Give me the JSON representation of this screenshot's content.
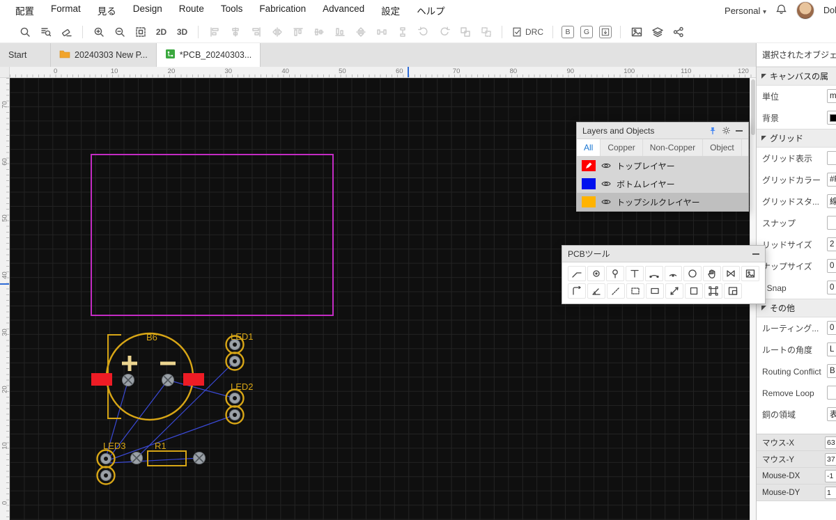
{
  "menu_bar": {
    "items": [
      "配置",
      "Format",
      "見る",
      "Design",
      "Route",
      "Tools",
      "Fabrication",
      "Advanced",
      "設定",
      "ヘルプ"
    ],
    "account_label": "Personal",
    "user_name": "Dol"
  },
  "toolbar": {
    "view_2d": "2D",
    "view_3d": "3D",
    "drc_label": "DRC",
    "bom_label": "B",
    "gerber_label": "G",
    "icons": [
      "search-icon",
      "net-search-icon",
      "eraser-icon",
      "zoom-in-icon",
      "zoom-out-icon",
      "zoom-fit-icon",
      "align-left-icon",
      "align-center-horizontal-icon",
      "align-right-icon",
      "flip-horizontal-icon",
      "align-top-icon",
      "align-middle-icon",
      "align-bottom-icon",
      "flip-vertical-icon",
      "distribute-horizontal-icon",
      "distribute-vertical-icon",
      "rotate-ccw-icon",
      "rotate-cw-icon",
      "group-icon",
      "ungroup-icon",
      "drc-icon",
      "export-board-icon",
      "image-export-icon",
      "layer-stack-icon",
      "share-icon"
    ]
  },
  "tabs": {
    "start": "Start",
    "project": "20240303 New P...",
    "pcb": "*PCB_20240303..."
  },
  "rulers": {
    "horizontal": [
      "0",
      "10",
      "20",
      "30",
      "40",
      "50",
      "60",
      "70",
      "80",
      "90",
      "100",
      "110",
      "120"
    ],
    "vertical": [
      "70",
      "60",
      "50",
      "40",
      "30",
      "20",
      "10",
      "0"
    ]
  },
  "canvas": {
    "colors": {
      "background": "#0f0f0f",
      "grid": "#232323",
      "board_outline": "#c32bc3",
      "silkscreen": "#d8a616",
      "top_layer_pad": "#ee1c25",
      "through_hole_pad": "#9ba1a7",
      "ratsnest": "#3a49d6"
    },
    "components": {
      "battery": "B6",
      "led1": "LED1",
      "led2": "LED2",
      "led3": "LED3",
      "resistor": "R1"
    }
  },
  "layers_panel": {
    "title": "Layers and Objects",
    "tabs": [
      "All",
      "Copper",
      "Non-Copper",
      "Object"
    ],
    "layers": [
      {
        "name": "トップレイヤー",
        "color": "#ff0000"
      },
      {
        "name": "ボトムレイヤー",
        "color": "#0011ee"
      },
      {
        "name": "トップシルクレイヤー",
        "color": "#ffb300"
      }
    ]
  },
  "tools_panel": {
    "title": "PCBツール",
    "tools": [
      "track-tool",
      "pad-tool",
      "via-tool",
      "text-tool",
      "arc-tool",
      "arc-by-center-tool",
      "circle-tool",
      "pan-tool",
      "connection-tool",
      "image-tool",
      "corner-tool",
      "protractor-tool",
      "construction-line-tool",
      "dashed-rect-tool",
      "rect-tool",
      "measure-tool",
      "region-tool",
      "board-outline-tool",
      "panel-tool"
    ]
  },
  "sidebar": {
    "header": "選択されたオブジェ",
    "sec1": "キャンバスの属",
    "unit_label": "単位",
    "unit_value": "mm",
    "bg_label": "背景",
    "bg_value": "#000000",
    "sec2": "グリッド",
    "grid_show_label": "グリッド表示",
    "grid_show_value": "",
    "grid_color_label": "グリッドカラー",
    "grid_color_value": "#F",
    "grid_style_label": "グリッドスタ...",
    "grid_style_value": "線",
    "snap_label": "スナップ",
    "snap_value": "",
    "grid_size_label": "リッドサイズ",
    "grid_size_value": "2",
    "snap_size_label": "ナップサイズ",
    "snap_size_value": "0",
    "alt_snap_label": "t Snap",
    "alt_snap_value": "0",
    "sec3": "その他",
    "routing_label": "ルーティング...",
    "routing_value": "0",
    "route_angle_label": "ルートの角度",
    "route_angle_value": "L",
    "conflict_label": "Routing Conflict",
    "conflict_value": "B",
    "remove_loop_label": "Remove Loop",
    "remove_loop_value": "",
    "copper_label": "銅の領域",
    "copper_value": "表",
    "mouse_x_label": "マウス-X",
    "mouse_x_value": "63",
    "mouse_y_label": "マウス-Y",
    "mouse_y_value": "37",
    "mouse_dx_label": "Mouse-DX",
    "mouse_dx_value": "-1",
    "mouse_dy_label": "Mouse-DY",
    "mouse_dy_value": "1"
  }
}
